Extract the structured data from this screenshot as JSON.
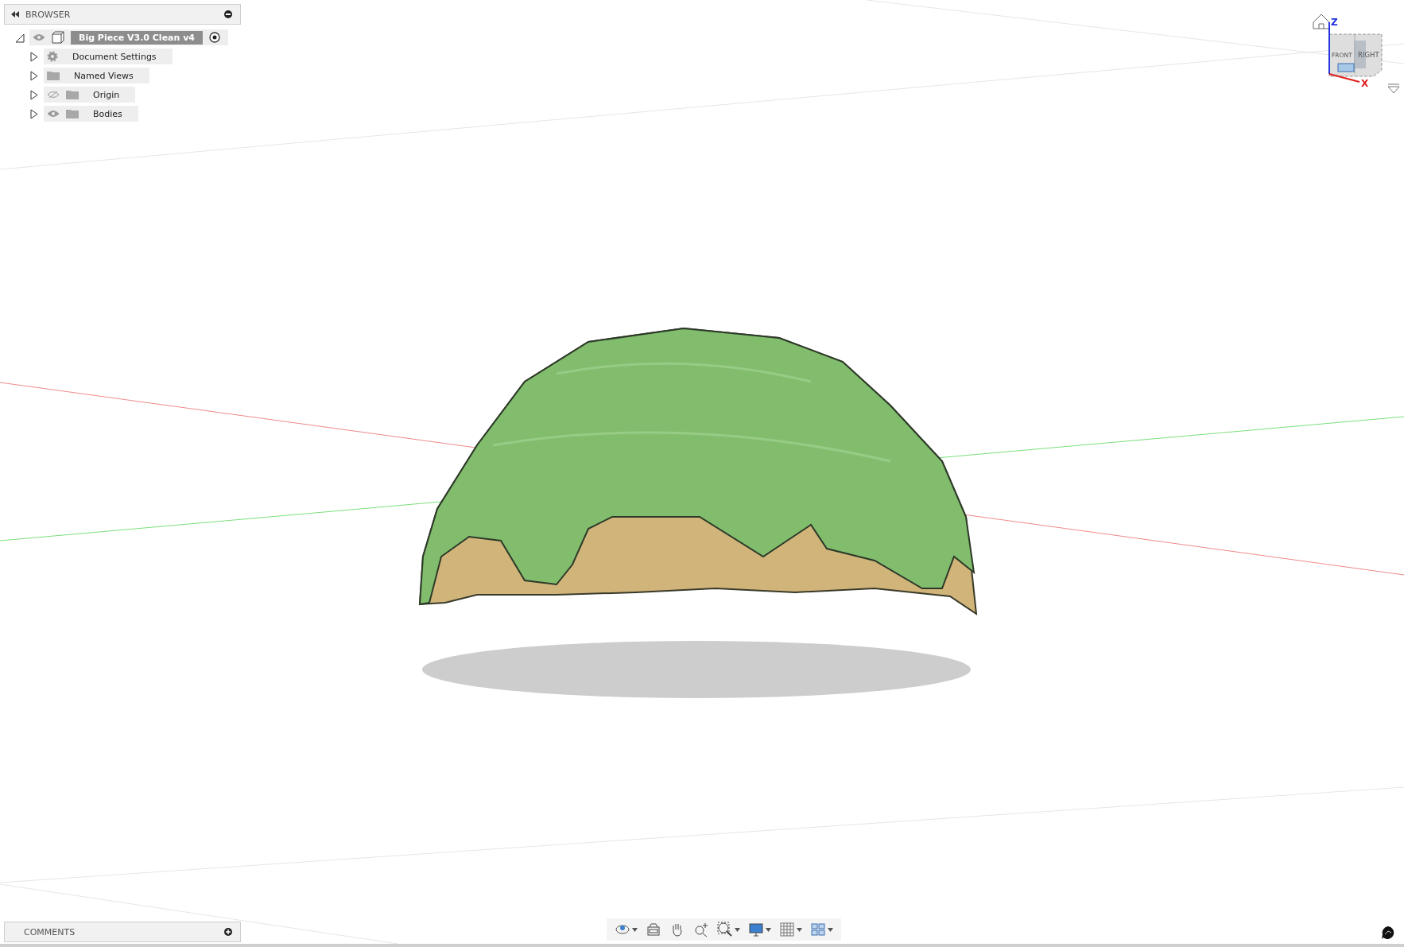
{
  "browser": {
    "title": "BROWSER",
    "items": [
      {
        "label": "Big Piece V3.0 Clean v4",
        "kind": "root",
        "expanded": true,
        "visible": true,
        "selected": true
      },
      {
        "label": "Document Settings",
        "kind": "settings",
        "expanded": false,
        "selected": false
      },
      {
        "label": "Named Views",
        "kind": "folder",
        "expanded": false,
        "selected": false
      },
      {
        "label": "Origin",
        "kind": "folder",
        "visible": false,
        "expanded": false,
        "selected": false
      },
      {
        "label": "Bodies",
        "kind": "folder",
        "visible": true,
        "expanded": false,
        "selected": false
      }
    ]
  },
  "view_cube": {
    "faces": [
      "FRONT",
      "RIGHT"
    ],
    "axes": [
      "Z",
      "X"
    ]
  },
  "comments": {
    "title": "COMMENTS"
  }
}
